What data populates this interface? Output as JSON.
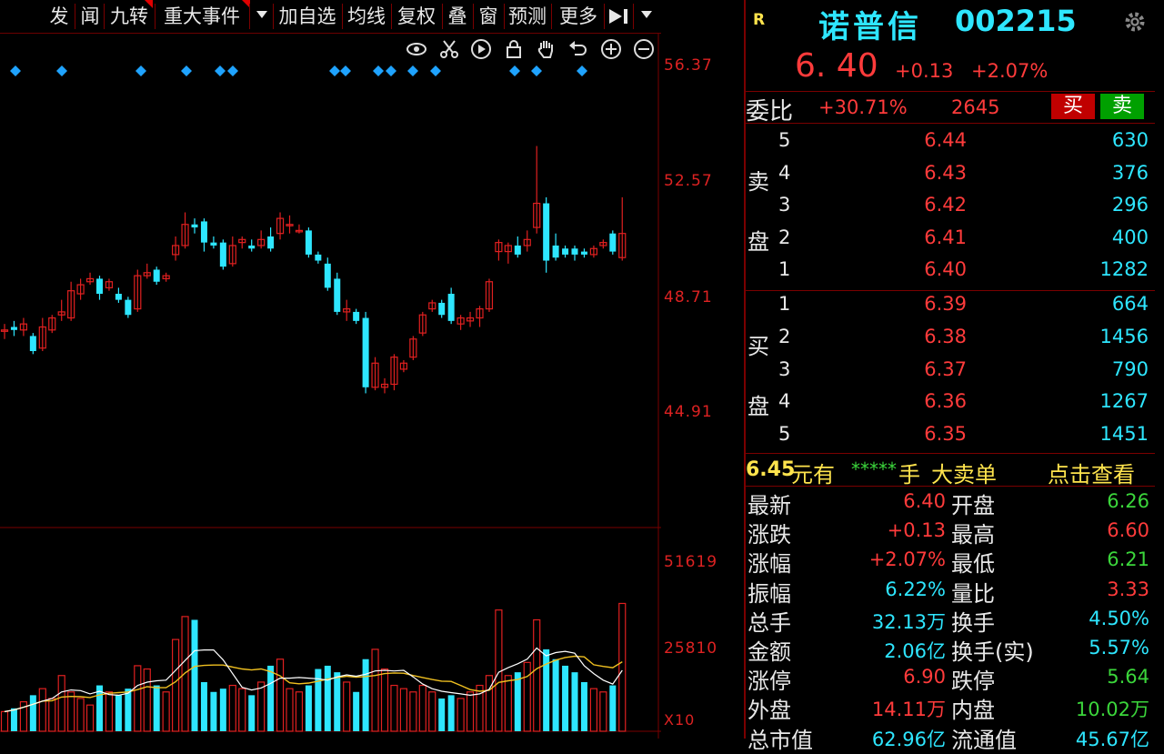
{
  "toolbar": {
    "items": [
      "发",
      "闻",
      "九转",
      "重大事件",
      "加自选",
      "均线",
      "复权",
      "叠",
      "窗",
      "预测",
      "更多"
    ]
  },
  "axis": {
    "price_ticks": [
      "56.37",
      "52.57",
      "48.71",
      "44.91"
    ],
    "volume_ticks": [
      "51619",
      "25810"
    ],
    "unit_label": "X10"
  },
  "chart_data": {
    "type": "candlestick",
    "price_axis": [
      44.91,
      48.71,
      52.57,
      56.37
    ],
    "volume_axis": [
      25810,
      51619
    ],
    "candles": [
      {
        "o": 47.6,
        "h": 47.8,
        "l": 47.3,
        "c": 47.6
      },
      {
        "o": 47.7,
        "h": 47.9,
        "l": 47.4,
        "c": 47.6
      },
      {
        "o": 47.6,
        "h": 48.0,
        "l": 47.4,
        "c": 47.8
      },
      {
        "o": 47.4,
        "h": 47.5,
        "l": 46.8,
        "c": 46.9
      },
      {
        "o": 47.0,
        "h": 48.0,
        "l": 46.9,
        "c": 47.7
      },
      {
        "o": 47.6,
        "h": 48.1,
        "l": 47.5,
        "c": 48.0
      },
      {
        "o": 48.1,
        "h": 48.6,
        "l": 47.9,
        "c": 48.2
      },
      {
        "o": 48.0,
        "h": 49.2,
        "l": 47.9,
        "c": 48.9
      },
      {
        "o": 48.8,
        "h": 49.3,
        "l": 48.6,
        "c": 49.1
      },
      {
        "o": 49.2,
        "h": 49.5,
        "l": 49.1,
        "c": 49.3
      },
      {
        "o": 49.3,
        "h": 49.4,
        "l": 48.6,
        "c": 48.8
      },
      {
        "o": 49.0,
        "h": 49.3,
        "l": 48.9,
        "c": 49.2
      },
      {
        "o": 48.8,
        "h": 49.0,
        "l": 48.5,
        "c": 48.6
      },
      {
        "o": 48.6,
        "h": 48.7,
        "l": 48.0,
        "c": 48.1
      },
      {
        "o": 48.3,
        "h": 49.6,
        "l": 48.2,
        "c": 49.4
      },
      {
        "o": 49.4,
        "h": 49.8,
        "l": 49.3,
        "c": 49.5
      },
      {
        "o": 49.6,
        "h": 49.7,
        "l": 49.1,
        "c": 49.2
      },
      {
        "o": 49.3,
        "h": 49.5,
        "l": 49.2,
        "c": 49.4
      },
      {
        "o": 50.1,
        "h": 50.7,
        "l": 49.9,
        "c": 50.4
      },
      {
        "o": 50.4,
        "h": 51.5,
        "l": 50.3,
        "c": 51.1
      },
      {
        "o": 51.1,
        "h": 51.3,
        "l": 50.8,
        "c": 51.0
      },
      {
        "o": 51.2,
        "h": 51.3,
        "l": 50.2,
        "c": 50.5
      },
      {
        "o": 50.5,
        "h": 50.7,
        "l": 50.3,
        "c": 50.4
      },
      {
        "o": 50.5,
        "h": 50.6,
        "l": 49.6,
        "c": 49.7
      },
      {
        "o": 49.8,
        "h": 50.7,
        "l": 49.7,
        "c": 50.4
      },
      {
        "o": 50.5,
        "h": 50.7,
        "l": 50.3,
        "c": 50.6
      },
      {
        "o": 50.4,
        "h": 50.6,
        "l": 50.2,
        "c": 50.3
      },
      {
        "o": 50.4,
        "h": 50.9,
        "l": 50.3,
        "c": 50.6
      },
      {
        "o": 50.7,
        "h": 51.0,
        "l": 50.2,
        "c": 50.3
      },
      {
        "o": 50.8,
        "h": 51.5,
        "l": 50.6,
        "c": 51.3
      },
      {
        "o": 51.1,
        "h": 51.4,
        "l": 50.8,
        "c": 51.1
      },
      {
        "o": 50.9,
        "h": 51.1,
        "l": 50.8,
        "c": 50.9
      },
      {
        "o": 50.9,
        "h": 51.0,
        "l": 50.0,
        "c": 50.1
      },
      {
        "o": 50.1,
        "h": 50.2,
        "l": 49.8,
        "c": 49.9
      },
      {
        "o": 49.8,
        "h": 50.0,
        "l": 48.9,
        "c": 49.0
      },
      {
        "o": 49.3,
        "h": 49.5,
        "l": 48.1,
        "c": 48.2
      },
      {
        "o": 48.2,
        "h": 48.6,
        "l": 47.9,
        "c": 48.3
      },
      {
        "o": 48.2,
        "h": 48.3,
        "l": 47.8,
        "c": 47.9
      },
      {
        "o": 48.0,
        "h": 48.2,
        "l": 45.5,
        "c": 45.7
      },
      {
        "o": 45.7,
        "h": 46.7,
        "l": 45.6,
        "c": 46.5
      },
      {
        "o": 45.7,
        "h": 46.0,
        "l": 45.5,
        "c": 45.8
      },
      {
        "o": 45.8,
        "h": 46.8,
        "l": 45.6,
        "c": 46.7
      },
      {
        "o": 46.3,
        "h": 46.6,
        "l": 46.2,
        "c": 46.5
      },
      {
        "o": 46.7,
        "h": 47.4,
        "l": 46.6,
        "c": 47.3
      },
      {
        "o": 47.5,
        "h": 48.2,
        "l": 47.4,
        "c": 48.1
      },
      {
        "o": 48.3,
        "h": 48.6,
        "l": 48.2,
        "c": 48.5
      },
      {
        "o": 48.5,
        "h": 48.6,
        "l": 48.0,
        "c": 48.1
      },
      {
        "o": 48.8,
        "h": 49.0,
        "l": 47.8,
        "c": 47.9
      },
      {
        "o": 47.8,
        "h": 48.1,
        "l": 47.6,
        "c": 48.0
      },
      {
        "o": 47.9,
        "h": 48.2,
        "l": 47.7,
        "c": 48.0
      },
      {
        "o": 48.0,
        "h": 48.4,
        "l": 47.7,
        "c": 48.3
      },
      {
        "o": 48.3,
        "h": 49.3,
        "l": 48.2,
        "c": 49.2
      },
      {
        "o": 50.2,
        "h": 50.6,
        "l": 49.9,
        "c": 50.5
      },
      {
        "o": 50.2,
        "h": 50.5,
        "l": 49.8,
        "c": 50.4
      },
      {
        "o": 50.4,
        "h": 50.7,
        "l": 50.0,
        "c": 50.1
      },
      {
        "o": 50.4,
        "h": 50.9,
        "l": 50.2,
        "c": 50.6
      },
      {
        "o": 51.0,
        "h": 53.7,
        "l": 50.8,
        "c": 51.8
      },
      {
        "o": 51.8,
        "h": 52.0,
        "l": 49.5,
        "c": 49.9
      },
      {
        "o": 50.4,
        "h": 50.8,
        "l": 49.9,
        "c": 50.0
      },
      {
        "o": 50.3,
        "h": 50.4,
        "l": 50.0,
        "c": 50.1
      },
      {
        "o": 50.3,
        "h": 50.4,
        "l": 49.9,
        "c": 50.1
      },
      {
        "o": 50.2,
        "h": 50.3,
        "l": 50.0,
        "c": 50.1
      },
      {
        "o": 50.1,
        "h": 50.4,
        "l": 50.0,
        "c": 50.3
      },
      {
        "o": 50.4,
        "h": 50.6,
        "l": 50.3,
        "c": 50.5
      },
      {
        "o": 50.8,
        "h": 50.9,
        "l": 50.1,
        "c": 50.2
      },
      {
        "o": 50.0,
        "h": 52.0,
        "l": 49.9,
        "c": 50.8
      }
    ],
    "volumes": [
      6000,
      7000,
      9000,
      11000,
      13000,
      10000,
      17000,
      12000,
      10000,
      8000,
      14000,
      12000,
      11000,
      13000,
      20000,
      19000,
      14000,
      12000,
      28000,
      35000,
      34000,
      15000,
      12000,
      13000,
      14000,
      13000,
      11000,
      15000,
      20000,
      22000,
      13000,
      12000,
      14000,
      19000,
      20000,
      18000,
      15000,
      12000,
      22000,
      25000,
      19000,
      14000,
      13000,
      12000,
      14000,
      12000,
      10000,
      11000,
      10000,
      12000,
      14000,
      17000,
      37000,
      17000,
      18000,
      21000,
      34000,
      25000,
      22000,
      20000,
      18000,
      15000,
      13000,
      12000,
      14000,
      39000
    ]
  },
  "markers": {
    "count": 22
  },
  "quote": {
    "badge": "R",
    "name": "诺普信",
    "code": "002215",
    "price": "6. 40",
    "change": "+0.13",
    "change_pct": "+2.07%",
    "weibi_label": "委比",
    "weibi_value": "+30.71%",
    "weicha_value": "2645",
    "buy_label": "买",
    "sell_label": "卖",
    "sell_label_1": "卖",
    "sell_label_2": "盘",
    "buy_side_label_1": "买",
    "buy_side_label_2": "盘",
    "asks": [
      {
        "n": "5",
        "price": "6.44",
        "vol": "630"
      },
      {
        "n": "4",
        "price": "6.43",
        "vol": "376"
      },
      {
        "n": "3",
        "price": "6.42",
        "vol": "296"
      },
      {
        "n": "2",
        "price": "6.41",
        "vol": "400"
      },
      {
        "n": "1",
        "price": "6.40",
        "vol": "1282"
      }
    ],
    "bids": [
      {
        "n": "1",
        "price": "6.39",
        "vol": "664"
      },
      {
        "n": "2",
        "price": "6.38",
        "vol": "1456"
      },
      {
        "n": "3",
        "price": "6.37",
        "vol": "790"
      },
      {
        "n": "4",
        "price": "6.36",
        "vol": "1267"
      },
      {
        "n": "5",
        "price": "6.35",
        "vol": "1451"
      }
    ],
    "notice_price": "6.45",
    "notice_unit": "元有",
    "notice_stars": "*****",
    "notice_hand": "手",
    "notice_big": "大卖单",
    "notice_link": "点击查看",
    "stats_left": [
      {
        "label": "最新",
        "value": "6.40",
        "color": "red"
      },
      {
        "label": "涨跌",
        "value": "+0.13",
        "color": "red"
      },
      {
        "label": "涨幅",
        "value": "+2.07%",
        "color": "red"
      },
      {
        "label": "振幅",
        "value": "6.22%",
        "color": "cyan"
      },
      {
        "label": "总手",
        "value": "32.13万",
        "color": "cyan"
      },
      {
        "label": "金额",
        "value": "2.06亿",
        "color": "cyan"
      },
      {
        "label": "涨停",
        "value": "6.90",
        "color": "red"
      },
      {
        "label": "外盘",
        "value": "14.11万",
        "color": "red"
      },
      {
        "label": "总市值",
        "value": "62.96亿",
        "color": "cyan"
      }
    ],
    "stats_right": [
      {
        "label": "开盘",
        "value": "6.26",
        "color": "green"
      },
      {
        "label": "最高",
        "value": "6.60",
        "color": "red"
      },
      {
        "label": "最低",
        "value": "6.21",
        "color": "green"
      },
      {
        "label": "量比",
        "value": "3.33",
        "color": "red"
      },
      {
        "label": "换手",
        "value": "4.50%",
        "color": "cyan"
      },
      {
        "label": "换手(实)",
        "value": "5.57%",
        "color": "cyan"
      },
      {
        "label": "跌停",
        "value": "5.64",
        "color": "green"
      },
      {
        "label": "内盘",
        "value": "10.02万",
        "color": "green"
      },
      {
        "label": "流通值",
        "value": "45.67亿",
        "color": "cyan"
      }
    ]
  },
  "colors": {
    "up": "#e02020",
    "down": "#2ee6ff",
    "grid": "#7a0000",
    "ma5": "#ffffff",
    "ma10": "#f0c020"
  }
}
